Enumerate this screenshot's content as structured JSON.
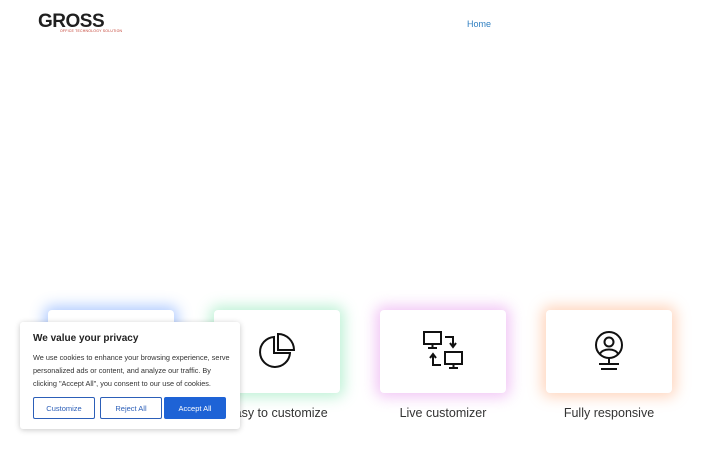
{
  "header": {
    "logo_text": "GROSS",
    "logo_tagline": "OFFICE TECHNOLOGY SOLUTION",
    "nav": [
      {
        "label": "Home"
      }
    ]
  },
  "features": [
    {
      "label": "",
      "icon": "blank"
    },
    {
      "label": "Easy to customize",
      "icon": "pie-chart-icon"
    },
    {
      "label": "Live customizer",
      "icon": "monitors-sync-icon"
    },
    {
      "label": "Fully responsive",
      "icon": "user-circle-icon"
    }
  ],
  "cookie_banner": {
    "title": "We value your privacy",
    "text": "We use cookies to enhance your browsing experience, serve personalized ads or content, and analyze our traffic. By clicking \"Accept All\", you consent to our use of cookies.",
    "buttons": {
      "customize": "Customize",
      "reject": "Reject All",
      "accept": "Accept All"
    }
  },
  "colors": {
    "accent": "#1e63d6",
    "nav_link": "#2f7fc1",
    "logo_tag": "#c0392b"
  }
}
